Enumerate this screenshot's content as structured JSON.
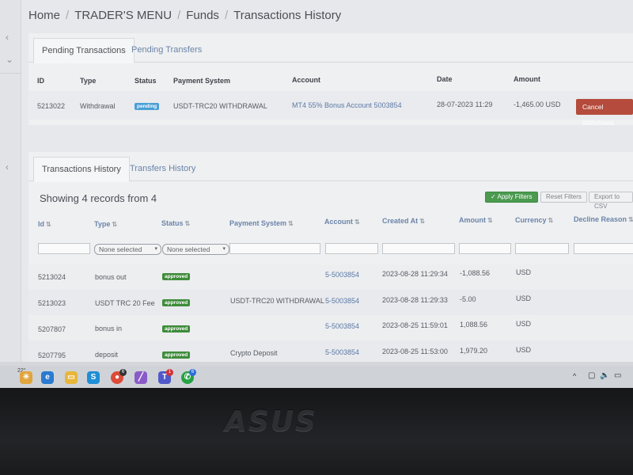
{
  "breadcrumb": [
    "Home",
    "TRADER'S MENU",
    "Funds",
    "Transactions History"
  ],
  "pending_panel": {
    "tabs": [
      {
        "label": "Pending Transactions",
        "active": true
      },
      {
        "label": "Pending Transfers",
        "active": false
      }
    ],
    "columns": [
      "ID",
      "Type",
      "Status",
      "Payment System",
      "Account",
      "Date",
      "Amount"
    ],
    "row": {
      "id": "5213022",
      "type": "Withdrawal",
      "status": "pending",
      "payment_system": "USDT-TRC20 WITHDRAWAL",
      "account": "MT4 55% Bonus Account 5003854",
      "date": "28-07-2023 11:29",
      "amount": "-1,465.00 USD",
      "action": "Cancel Withdrawa"
    }
  },
  "history_panel": {
    "tabs": [
      {
        "label": "Transactions History",
        "active": true
      },
      {
        "label": "Transfers History",
        "active": false
      }
    ],
    "summary": "Showing 4 records from 4",
    "buttons": {
      "apply": "Apply Filters",
      "reset": "Reset Filters",
      "export": "Export to CSV"
    },
    "columns": [
      "Id",
      "Type",
      "Status",
      "Payment System",
      "Account",
      "Created At",
      "Amount",
      "Currency",
      "Decline Reason"
    ],
    "filters": {
      "type_select": "None selected",
      "status_select": "None selected"
    },
    "rows": [
      {
        "id": "5213024",
        "type": "bonus out",
        "status": "approved",
        "payment_system": "",
        "account": "5-5003854",
        "created_at": "2023-08-28 11:29:34",
        "amount": "-1,088.56",
        "currency": "USD"
      },
      {
        "id": "5213023",
        "type": "USDT TRC 20 Fee",
        "status": "approved",
        "payment_system": "USDT-TRC20 WITHDRAWAL",
        "account": "5-5003854",
        "created_at": "2023-08-28 11:29:33",
        "amount": "-5.00",
        "currency": "USD"
      },
      {
        "id": "5207807",
        "type": "bonus in",
        "status": "approved",
        "payment_system": "",
        "account": "5-5003854",
        "created_at": "2023-08-25 11:59:01",
        "amount": "1,088.56",
        "currency": "USD"
      },
      {
        "id": "5207795",
        "type": "deposit",
        "status": "approved",
        "payment_system": "Crypto Deposit",
        "account": "5-5003854",
        "created_at": "2023-08-25 11:53:00",
        "amount": "1,979.20",
        "currency": "USD"
      }
    ]
  },
  "taskbar": {
    "weather_temp": "22°",
    "badges": {
      "chrome": "6",
      "teams": "1",
      "whatsapp": "6"
    }
  },
  "brand": "ASUS",
  "colors": {
    "accent_link": "#5d79a6",
    "approved": "#3e8c3a",
    "pending": "#4a9fd6",
    "danger": "#b44b3c"
  }
}
